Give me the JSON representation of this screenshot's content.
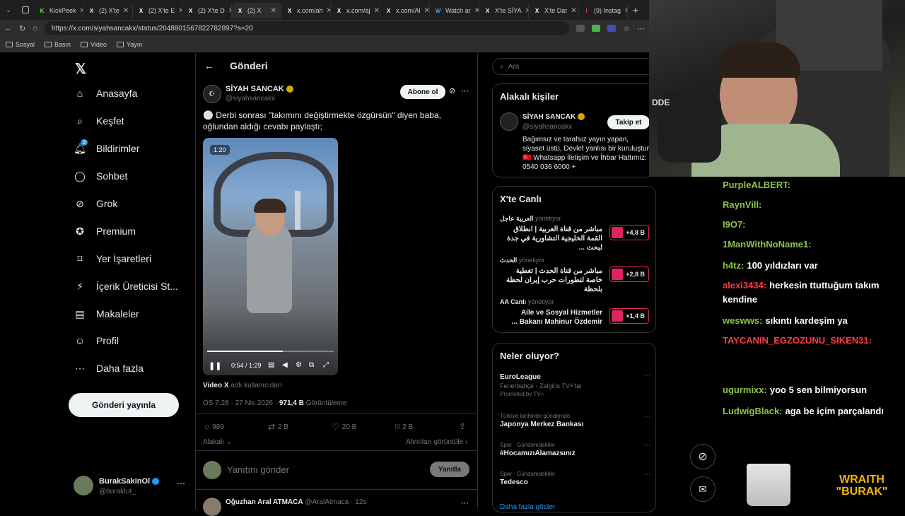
{
  "browser": {
    "tabs": [
      {
        "label": "KickPeek",
        "color": "#53fc18",
        "glyph": "K"
      },
      {
        "label": "(2) X'te",
        "color": "#fff",
        "glyph": "X"
      },
      {
        "label": "(2) X'te E",
        "color": "#fff",
        "glyph": "X"
      },
      {
        "label": "(2) X'te D",
        "color": "#fff",
        "glyph": "X"
      },
      {
        "label": "(2) X",
        "color": "#fff",
        "glyph": "X"
      },
      {
        "label": "x.com/ah",
        "color": "#fff",
        "glyph": "X"
      },
      {
        "label": "x.com/aj",
        "color": "#fff",
        "glyph": "X"
      },
      {
        "label": "x.com/Al",
        "color": "#fff",
        "glyph": "X"
      },
      {
        "label": "Watch ar",
        "color": "#4aa3ff",
        "glyph": "W"
      },
      {
        "label": "X'te SİYA",
        "color": "#fff",
        "glyph": "X"
      },
      {
        "label": "X'te Dar",
        "color": "#fff",
        "glyph": "X"
      },
      {
        "label": "(9) Instag",
        "color": "#e1306c",
        "glyph": "I"
      }
    ],
    "url": "https://x.com/siyahsancakx/status/2048801567822782897?s=20",
    "bookmarks": [
      "Sosyal",
      "Basın",
      "Video",
      "Yayın"
    ]
  },
  "nav": {
    "items": [
      {
        "label": "Anasayfa",
        "icon": "home-icon"
      },
      {
        "label": "Keşfet",
        "icon": "search-icon"
      },
      {
        "label": "Bildirimler",
        "icon": "bell-icon",
        "badge": "2"
      },
      {
        "label": "Sohbet",
        "icon": "chat-icon"
      },
      {
        "label": "Grok",
        "icon": "grok-icon"
      },
      {
        "label": "Premium",
        "icon": "premium-icon"
      },
      {
        "label": "Yer İşaretleri",
        "icon": "bookmark-icon"
      },
      {
        "label": "İçerik Üreticisi St...",
        "icon": "creator-icon"
      },
      {
        "label": "Makaleler",
        "icon": "article-icon"
      },
      {
        "label": "Profil",
        "icon": "profile-icon"
      },
      {
        "label": "Daha fazla",
        "icon": "more-icon"
      }
    ],
    "post_button": "Gönderi yayınla",
    "me": {
      "name": "BurakSakinOl",
      "handle": "@buraktut_"
    }
  },
  "main": {
    "header_title": "Gönderi",
    "author": {
      "name": "SİYAH SANCAK",
      "handle": "@siyahsancakx"
    },
    "follow_label": "Abone ol",
    "text": "⚪ Derbi sonrası \"takımını değiştirmekte özgürsün\" diyen baba, oğlundan aldığı cevabı paylaştı;",
    "video": {
      "badge": "1:20",
      "time": "0:54 / 1:29",
      "progress": 0.6
    },
    "attribution_bold": "Video X",
    "attribution_rest": "adlı kullanıcıdan",
    "meta_time": "ÖS 7:28 · 27 Nis 2026 · ",
    "meta_views_bold": "971,4 B",
    "meta_views_label": "Görüntüleme",
    "actions": {
      "replies": "989",
      "reposts": "2 B",
      "likes": "20 B",
      "bookmarks": "2 B"
    },
    "relevant_label": "Alakalı",
    "quotes_label": "Alıntıları görüntüle",
    "reply_placeholder": "Yanıtını gönder",
    "reply_button": "Yanıtla",
    "next_reply": {
      "name": "Oğuzhan Aral ATMACA",
      "handle": "@AralAtmaca",
      "time": "· 12s"
    }
  },
  "right": {
    "search_placeholder": "Ara",
    "people": {
      "title": "Alakalı kişiler",
      "name": "SİYAH SANCAK",
      "handle": "@siyahsancakx",
      "follow": "Takip et",
      "bio": "Bağımsız ve tarafsız yayın yapan, siyaset üstü, Devlet yanlısı bir kuruluştur. 🇹🇷 Whatsapp İletişim ve İhbar Hattımız: 0540 036 6000 +"
    },
    "live": {
      "title": "X'te Canlı",
      "items": [
        {
          "host": "العربية عاجل",
          "host_suffix": "yönetiyor",
          "text": "مباشر من قناة العربية | انطلاق القمة الخليجية التشاورية في جدة لبحث ...",
          "count": "+4,8 B",
          "color": "#e0245e"
        },
        {
          "host": "الحدث",
          "host_suffix": "yönetiyor",
          "text": "مباشر من قناة الحدث | تغطية خاصة لتطورات حرب إيران لحظة بلحظة",
          "count": "+2,8 B",
          "color": "#e0245e"
        },
        {
          "host": "AA Canlı",
          "host_suffix": "yönetiyor",
          "text": "Aile ve Sosyal Hizmetler Bakanı Mahinur Özdemir ...",
          "count": "+1,4 B",
          "color": "#e0245e"
        }
      ]
    },
    "trends": {
      "title": "Neler oluyor?",
      "items": [
        {
          "context": "",
          "name": "EuroLeague",
          "sub": "Fenerbahçe - Zalgiris TV+'tal",
          "promo": "Promoted by TV+"
        },
        {
          "context": "Türkiye tarihinde gündemde",
          "name": "Japonya Merkez Bankası",
          "sub": "",
          "promo": ""
        },
        {
          "context": "Spor · Gündemdekiler",
          "name": "#HocamızıAlamazsınız",
          "sub": "",
          "promo": ""
        },
        {
          "context": "Spor · Gündemdekiler",
          "name": "Tedesco",
          "sub": "",
          "promo": ""
        }
      ],
      "more": "Daha fazla göster"
    }
  },
  "stream": {
    "overlay_tag": "DDE",
    "chat": [
      {
        "user": "PurpleALBERT:",
        "msg": "",
        "color": "#8bc34a"
      },
      {
        "user": "RaynVill:",
        "msg": "",
        "color": "#8bc34a"
      },
      {
        "user": "I9O7:",
        "msg": "",
        "color": "#8bc34a"
      },
      {
        "user": "1ManWithNoName1:",
        "msg": "",
        "color": "#8bc34a"
      },
      {
        "user": "h4tz:",
        "msg": "100 yıldızları var",
        "color": "#8bc34a"
      },
      {
        "user": "alexi3434:",
        "msg": "herkesin ttuttuğum takım kendine",
        "color": "#ff3b4a"
      },
      {
        "user": "weswws:",
        "msg": "sıkıntı kardeşim ya",
        "color": "#8bc34a"
      },
      {
        "user": "TAYCANIN_EGZOZUNU_SIKEN31:",
        "msg": "",
        "color": "#ff3b4a"
      },
      {
        "user": "ugurmixx:",
        "msg": "yoo 5 sen bilmiyorsun",
        "color": "#8bc34a"
      },
      {
        "user": "LudwigBlack:",
        "msg": "aga be içim parçalandı",
        "color": "#8bc34a"
      }
    ],
    "logo_line1": "WRAITH",
    "logo_line2": "\"BURAK\""
  }
}
